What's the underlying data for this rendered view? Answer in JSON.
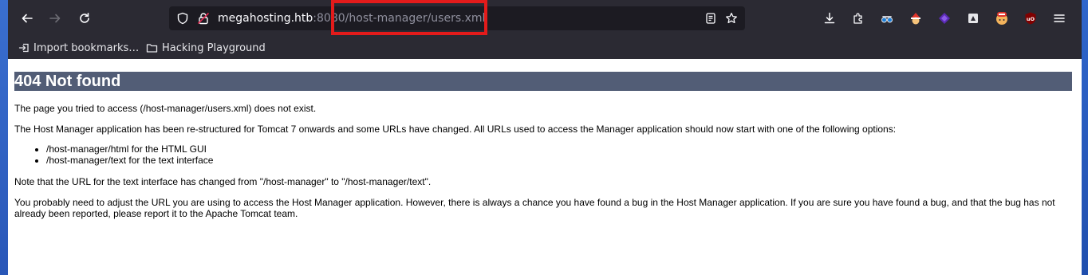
{
  "browser": {
    "url": {
      "host": "megahosting.htb",
      "port": ":808",
      "path_hidden": "0",
      "path": "/host-manager/users.xml"
    },
    "nav": {
      "back_icon": "back-arrow-icon",
      "forward_icon": "forward-arrow-icon",
      "reload_icon": "reload-icon"
    },
    "toolbar_icons": [
      "download-icon",
      "extensions-icon",
      "spy-glasses-icon",
      "santa-extension-icon",
      "purple-diamond-icon",
      "card-extension-icon",
      "red-face-extension-icon",
      "ublock-icon",
      "hamburger-menu-icon"
    ],
    "bookmarks": [
      {
        "label": "Import bookmarks…",
        "icon": "import-icon"
      },
      {
        "label": "Hacking Playground",
        "icon": "folder-icon"
      }
    ],
    "accent": "#e31b1b"
  },
  "page": {
    "title": "404 Not found",
    "p1": "The page you tried to access (/host-manager/users.xml) does not exist.",
    "p2": "The Host Manager application has been re-structured for Tomcat 7 onwards and some URLs have changed. All URLs used to access the Manager application should now start with one of the following options:",
    "options": [
      "/host-manager/html for the HTML GUI",
      "/host-manager/text for the text interface"
    ],
    "p3": "Note that the URL for the text interface has changed from \"/host-manager\" to \"/host-manager/text\".",
    "p4": "You probably need to adjust the URL you are using to access the Host Manager application. However, there is always a chance you have found a bug in the Host Manager application. If you are sure you have found a bug, and that the bug has not already been reported, please report it to the Apache Tomcat team.",
    "header_color": "#525d76"
  }
}
